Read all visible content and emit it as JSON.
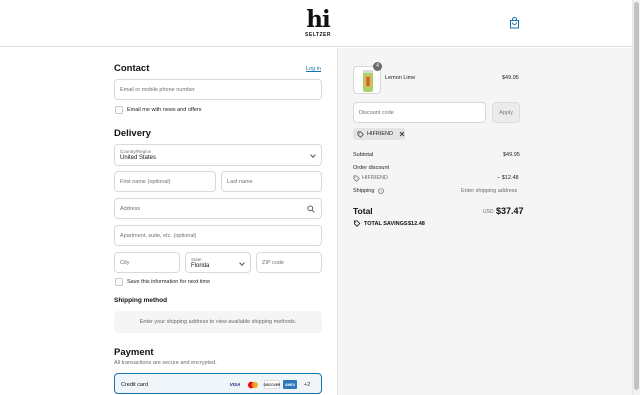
{
  "header": {
    "logo_text": "hi",
    "logo_sub": "SELTZER",
    "cart_icon": "shopping-bag-icon"
  },
  "contact": {
    "title": "Contact",
    "login_link": "Log in",
    "email_placeholder": "Email or mobile phone number",
    "newsletter_label": "Email me with news and offers"
  },
  "delivery": {
    "title": "Delivery",
    "country_label": "Country/Region",
    "country_value": "United States",
    "first_name_placeholder": "First name (optional)",
    "last_name_placeholder": "Last name",
    "address_placeholder": "Address",
    "apartment_placeholder": "Apartment, suite, etc. (optional)",
    "city_placeholder": "City",
    "state_label": "State",
    "state_value": "Florida",
    "zip_placeholder": "ZIP code",
    "save_info_label": "Save this information for next time"
  },
  "shipping": {
    "title": "Shipping method",
    "message": "Enter your shipping address to view available shipping methods."
  },
  "payment": {
    "title": "Payment",
    "note": "All transactions are secure and encrypted.",
    "method_label": "Credit card",
    "cards": [
      "VISA",
      "MC",
      "DISCOVER",
      "AMEX"
    ],
    "more_cards": "+2"
  },
  "summary": {
    "item": {
      "name": "Lemon Lime",
      "quantity": "4",
      "price": "$49.95"
    },
    "discount_placeholder": "Discount code",
    "apply_label": "Apply",
    "applied_code": "HIFRIEND",
    "subtotal_label": "Subtotal",
    "subtotal_value": "$49.95",
    "order_discount_label": "Order discount",
    "discount_code": "HIFRIEND",
    "discount_value": "− $12.48",
    "shipping_label": "Shipping",
    "shipping_value": "Enter shipping address",
    "total_label": "Total",
    "total_currency": "USD",
    "total_value": "$37.47",
    "savings_label": "TOTAL SAVINGS",
    "savings_value": "$12.48"
  },
  "colors": {
    "link": "#1773b0",
    "summary_bg": "#f5f5f5"
  }
}
